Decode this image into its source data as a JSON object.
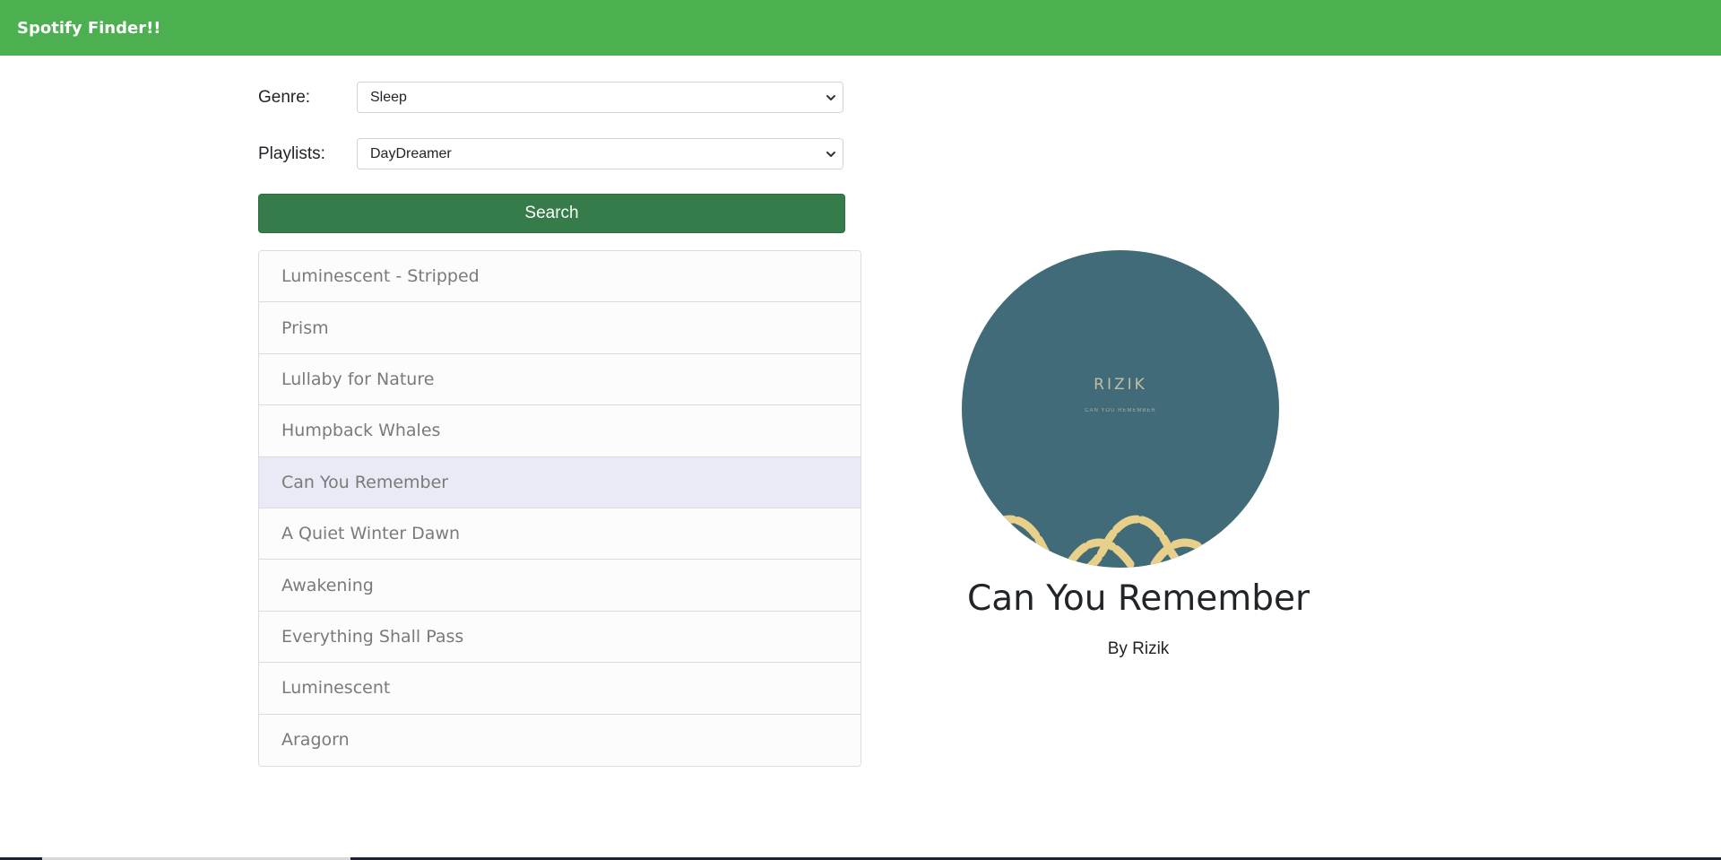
{
  "header": {
    "brand": "Spotify Finder!!"
  },
  "form": {
    "genre_label": "Genre:",
    "genre_value": "Sleep",
    "playlists_label": "Playlists:",
    "playlists_value": "DayDreamer",
    "search_label": "Search"
  },
  "tracks": [
    {
      "label": "Luminescent - Stripped"
    },
    {
      "label": "Prism"
    },
    {
      "label": "Lullaby for Nature"
    },
    {
      "label": "Humpback Whales"
    },
    {
      "label": "Can You Remember"
    },
    {
      "label": "A Quiet Winter Dawn"
    },
    {
      "label": "Awakening"
    },
    {
      "label": "Everything Shall Pass"
    },
    {
      "label": "Luminescent"
    },
    {
      "label": "Aragorn"
    }
  ],
  "selected_track_index": 4,
  "detail": {
    "cover_artist_text": "RIZIK",
    "cover_sub_text": "CAN YOU REMEMBER",
    "title": "Can You Remember",
    "artist": "By Rizik"
  },
  "colors": {
    "navbar": "#4caf50",
    "search_button": "#367c4a",
    "active_row": "#e9eaf5",
    "cover_bg": "#426b7a",
    "cover_wave": "#e8cf8a"
  }
}
